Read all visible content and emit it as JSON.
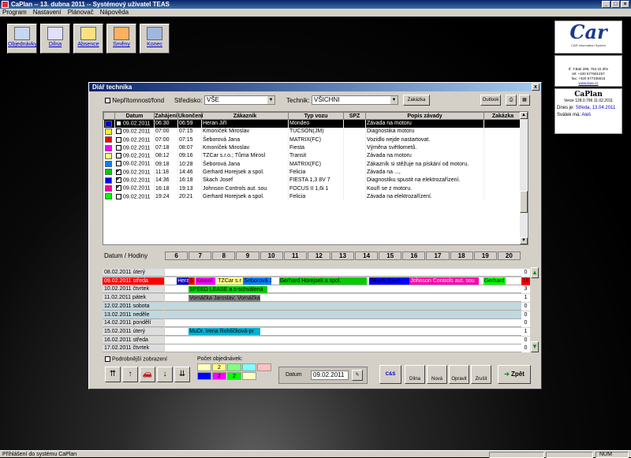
{
  "window": {
    "title": "CaPlan -- 13. dubna 2011 -- Systémový uživatel TEAS"
  },
  "menu": [
    "Program",
    "Nastavení",
    "Plánovač",
    "Nápověda"
  ],
  "toolbar": [
    {
      "label": "Objednávky",
      "icon": "orders-icon",
      "color": "#c7d7f2"
    },
    {
      "label": "Dílna",
      "icon": "workshop-icon",
      "color": "#e0e0ff"
    },
    {
      "label": "Absence",
      "icon": "absence-icon",
      "color": "#ffe080"
    },
    {
      "label": "Směny",
      "icon": "shifts-icon",
      "color": "#ffb060"
    },
    {
      "label": "Konec",
      "icon": "exit-door-icon",
      "color": "#a0b8e0"
    }
  ],
  "logo": {
    "text": "Car",
    "sub": "CAR Information System"
  },
  "company": {
    "address": "tř. T.Bati 299, 764 22 Zlín",
    "tel": "tel: +420 577601257",
    "fax": "fax: +420 577105516",
    "web": "www.teas.cz"
  },
  "caplan": {
    "name": "CaPlan",
    "version": "Verze 128.0.796  11.02.2011",
    "today_label": "Dnes je:",
    "today_value": "Středa, 13.04.2011",
    "nameday_label": "Svátek má:",
    "nameday_value": "Aleš"
  },
  "dialog": {
    "title": "Diář technika",
    "close": "x",
    "nepritomnost_label": "Nepřítomnost/fond",
    "stredisko_label": "Středisko:",
    "stredisko_value": "VŠE",
    "technik_label": "Technik:",
    "technik_value": "VŠICHNI",
    "zakazka_btn": "Zakázka",
    "outlook_btn": "Outlook"
  },
  "table": {
    "columns": [
      "Datum",
      "Zahájení",
      "Ukončení",
      "Zákazník",
      "Typ vozu",
      "SPZ",
      "Popis závady",
      "Zakázka"
    ],
    "rows": [
      {
        "color": "#0000cc",
        "check": false,
        "date": "09.02.2011",
        "start": "06:30",
        "end": "06:59",
        "customer": "Heran Jiří",
        "car": "Mondeo",
        "spz": "",
        "desc": "Závada na motoru",
        "order": "",
        "selected": true
      },
      {
        "color": "#ffff00",
        "check": false,
        "date": "09.02.2011",
        "start": "07:00",
        "end": "07:15",
        "customer": "Kmoníček Miroslav",
        "car": "TUCSON(JM)",
        "spz": "",
        "desc": "Diagnostika motoru",
        "order": ""
      },
      {
        "color": "#ff0000",
        "check": false,
        "date": "09.02.2011",
        "start": "07:00",
        "end": "07:15",
        "customer": "Šeborová Jana",
        "car": "MATRIX(FC)",
        "spz": "",
        "desc": "Vozidlo nejde nastartovat.",
        "order": ""
      },
      {
        "color": "#ff00ff",
        "check": false,
        "date": "09.02.2011",
        "start": "07:18",
        "end": "08:07",
        "customer": "Kmoníček Miroslav",
        "car": "Fiesta",
        "spz": "",
        "desc": "Výměna světlometů.",
        "order": ""
      },
      {
        "color": "#ffff80",
        "check": false,
        "date": "09.02.2011",
        "start": "08:12",
        "end": "09:16",
        "customer": "TZCar s.r.o.; Tůma Mirosl",
        "car": "Transit",
        "spz": "",
        "desc": "Závada na motoru",
        "order": ""
      },
      {
        "color": "#0080ff",
        "check": false,
        "date": "09.02.2011",
        "start": "09:18",
        "end": "10:28",
        "customer": "Šeborová Jana",
        "car": "MATRIX(FC)",
        "spz": "",
        "desc": "Zákazník si stěžuje na pískání od motoru.",
        "order": ""
      },
      {
        "color": "#00cc00",
        "check": true,
        "date": "09.02.2011",
        "start": "11:18",
        "end": "14:46",
        "customer": "Gerhard Horejsek a spol.",
        "car": "Felicia",
        "spz": "",
        "desc": "Závada na ...,",
        "order": ""
      },
      {
        "color": "#0000ff",
        "check": true,
        "date": "09.02.2011",
        "start": "14:36",
        "end": "16:18",
        "customer": "Škach Josef",
        "car": "FIESTA 1,3 8V 7",
        "spz": "",
        "desc": "Diagnostiku spustit na elektrozařízení.",
        "order": ""
      },
      {
        "color": "#ff00aa",
        "check": true,
        "date": "09.02.2011",
        "start": "16:18",
        "end": "19:13",
        "customer": "Johnson Controls aut. sou",
        "car": "FOCUS II 1,6i 1",
        "spz": "",
        "desc": "Kouří se z motoru.",
        "order": ""
      },
      {
        "color": "#00ff00",
        "check": false,
        "date": "09.02.2011",
        "start": "19:24",
        "end": "20:21",
        "customer": "Gerhard Horejsek a spol.",
        "car": "Felicia",
        "spz": "",
        "desc": "Závada na elektrozařízení.",
        "order": ""
      }
    ]
  },
  "timeline": {
    "header_label": "Datum / Hodiny",
    "hours": [
      "6",
      "7",
      "8",
      "9",
      "10",
      "11",
      "12",
      "13",
      "14",
      "15",
      "16",
      "17",
      "18",
      "19",
      "20"
    ],
    "days": [
      {
        "label": "08.02.2011  úterý",
        "count": "0",
        "bg": "#ffffff"
      },
      {
        "label": "09.02.2011  středa",
        "count": "10",
        "bg": "#ffffff",
        "selected": true
      },
      {
        "label": "10.02.2011  čtvrtek",
        "count": "3",
        "bg": "#ffffff"
      },
      {
        "label": "11.02.2011  pátek",
        "count": "1",
        "bg": "#ffffff"
      },
      {
        "label": "12.02.2011  sobota",
        "count": "0",
        "bg": "#c0d8e0"
      },
      {
        "label": "13.02.2011  neděle",
        "count": "0",
        "bg": "#c0d8e0"
      },
      {
        "label": "14.02.2011  pondělí",
        "count": "0",
        "bg": "#ffffff"
      },
      {
        "label": "15.02.2011  úterý",
        "count": "1",
        "bg": "#ffffff"
      },
      {
        "label": "16.02.2011  středa",
        "count": "0",
        "bg": "#ffffff"
      },
      {
        "label": "17.02.2011  čtvrtek",
        "count": "0",
        "bg": "#ffffff"
      }
    ],
    "bars": [
      {
        "day": 1,
        "start": 6.5,
        "end": 6.98,
        "text": "Hera",
        "color": "#0000cc",
        "fg": "#ffffff"
      },
      {
        "day": 1,
        "start": 7.0,
        "end": 7.25,
        "text": "Š",
        "color": "#ff0000",
        "fg": "#000000"
      },
      {
        "day": 1,
        "start": 7.3,
        "end": 8.12,
        "text": "Kmoní",
        "color": "#ff00ff",
        "fg": "#000000"
      },
      {
        "day": 1,
        "start": 8.2,
        "end": 9.27,
        "text": "TZCar s.r",
        "color": "#ffff80",
        "fg": "#000000"
      },
      {
        "day": 1,
        "start": 9.3,
        "end": 10.47,
        "text": "Šeborová J",
        "color": "#0080ff",
        "fg": "#000000"
      },
      {
        "day": 1,
        "start": 10.8,
        "end": 14.5,
        "text": "Gerhard Horejsek a spol.",
        "color": "#00cc00",
        "fg": "#000000"
      },
      {
        "day": 1,
        "start": 14.6,
        "end": 16.3,
        "text": "Škach Josef",
        "color": "#0000ff",
        "fg": "#000000"
      },
      {
        "day": 1,
        "start": 16.3,
        "end": 19.2,
        "text": "Johnson Controls aut. sou",
        "color": "#ff00aa",
        "fg": "#ffffff"
      },
      {
        "day": 1,
        "start": 19.4,
        "end": 20.35,
        "text": "Gerhard",
        "color": "#00ff00",
        "fg": "#000000"
      },
      {
        "day": 2,
        "start": 7.0,
        "end": 10.3,
        "text": "SPEED LEASE a.s-schválená",
        "color": "#00cc00",
        "fg": "#000000"
      },
      {
        "day": 3,
        "start": 7.0,
        "end": 10.0,
        "text": "Vomáčka Jaroslav; Vomáčka",
        "color": "#808080",
        "fg": "#000000"
      },
      {
        "day": 7,
        "start": 7.0,
        "end": 10.0,
        "text": "MuDr. Irena Rohlíčková-pr",
        "color": "#00b0d0",
        "fg": "#000000"
      }
    ]
  },
  "bottom": {
    "detail_label": "Podrobnější zobrazení",
    "pocet_label": "Počet objednávek:",
    "counts": [
      {
        "value": "",
        "bg": "#ffffc0"
      },
      {
        "value": "2",
        "bg": "#ffff80"
      },
      {
        "value": "",
        "bg": "#80ff80"
      },
      {
        "value": "",
        "bg": "#80ffff"
      },
      {
        "value": "",
        "bg": "#ffc0c0"
      },
      {
        "value": "",
        "bg": "#0000ff"
      },
      {
        "value": "2",
        "bg": "#ff00ff"
      },
      {
        "value": "2",
        "bg": "#00ff00"
      },
      {
        "value": "",
        "bg": "#ffffc0"
      }
    ],
    "datum_label": "Datum",
    "datum_value": "09.02.2011",
    "actions": [
      "Dílna",
      "Nová",
      "Opravit",
      "Zrušit",
      "Zpět"
    ]
  },
  "statusbar": {
    "text": "Příhlášení do systému CaPlan",
    "num": "NUM"
  }
}
